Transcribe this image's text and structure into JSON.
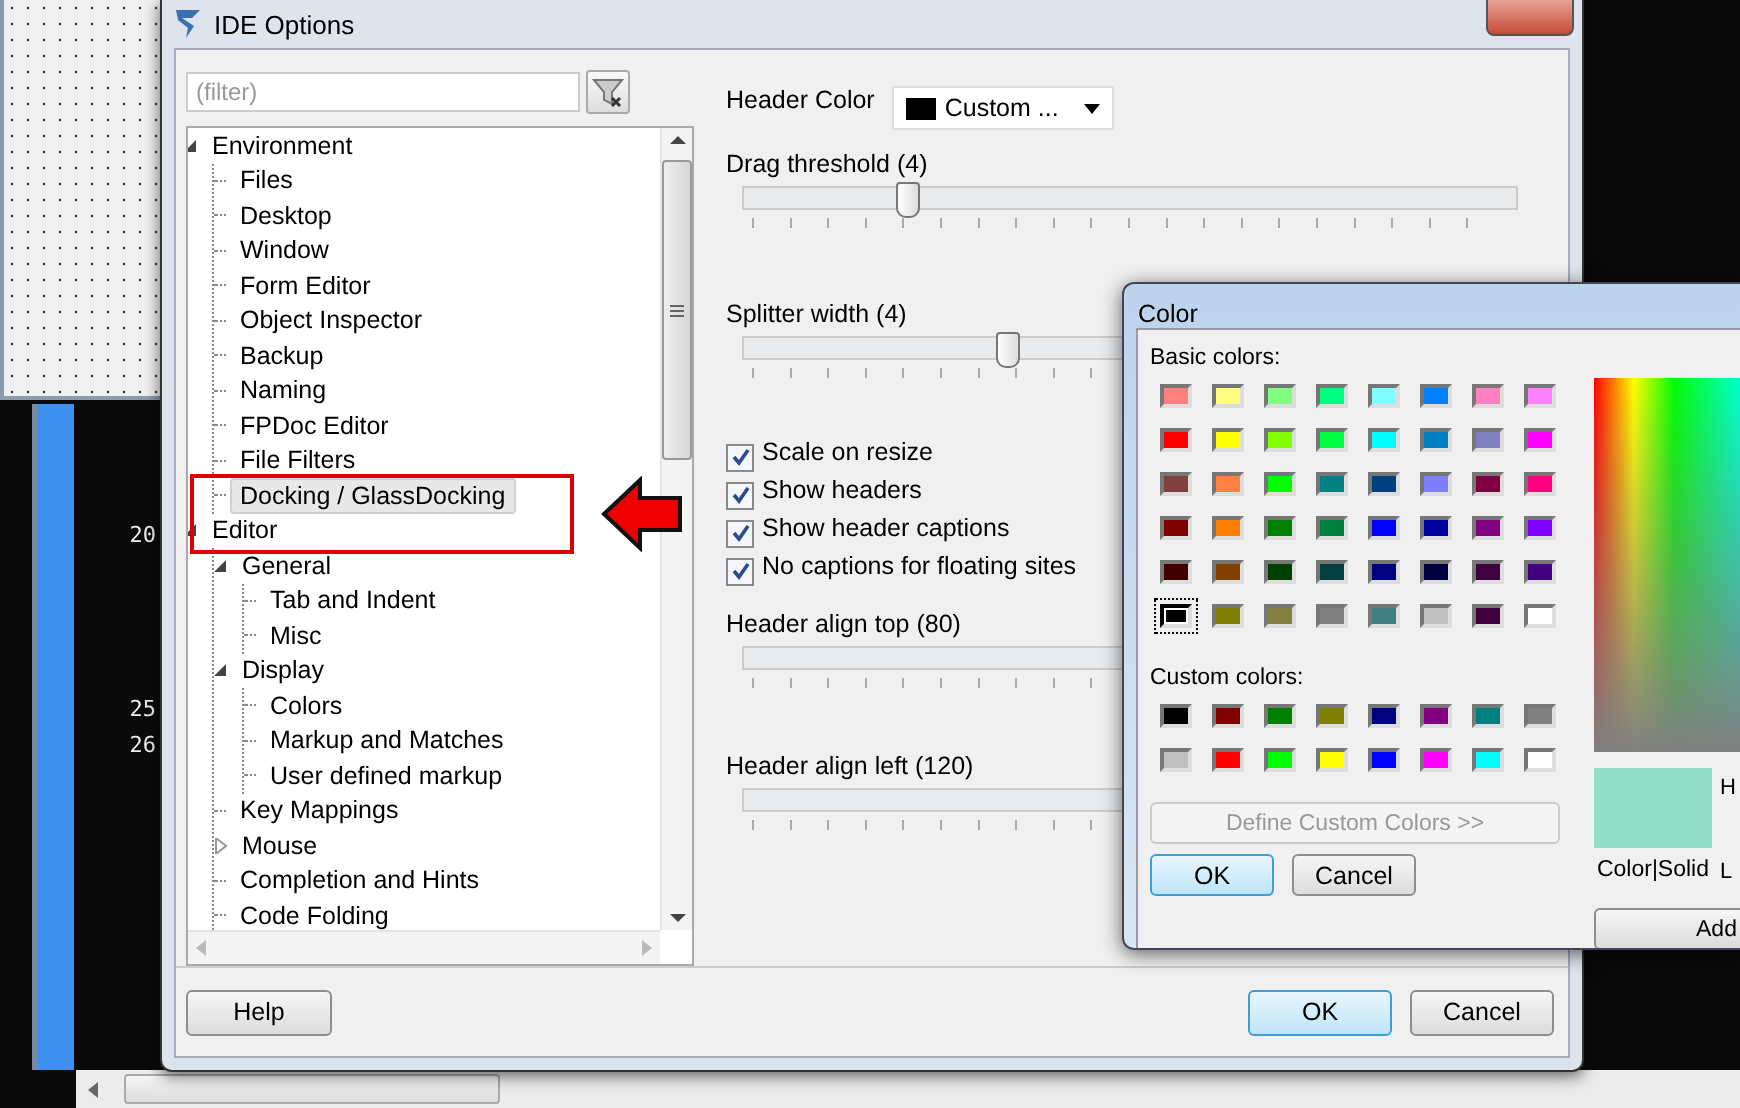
{
  "editor_gutter": [
    {
      "number": "20"
    },
    {
      "number": "25"
    },
    {
      "number": "26"
    }
  ],
  "window": {
    "title": "IDE Options"
  },
  "filter": {
    "placeholder": "(filter)"
  },
  "tree": [
    {
      "label": "Environment",
      "expanded": true,
      "selected": false,
      "children": [
        {
          "label": "Files",
          "selected": false
        },
        {
          "label": "Desktop",
          "selected": false
        },
        {
          "label": "Window",
          "selected": false
        },
        {
          "label": "Form Editor",
          "selected": false
        },
        {
          "label": "Object Inspector",
          "selected": false
        },
        {
          "label": "Backup",
          "selected": false
        },
        {
          "label": "Naming",
          "selected": false
        },
        {
          "label": "FPDoc Editor",
          "selected": false
        },
        {
          "label": "File Filters",
          "selected": false
        },
        {
          "label": "Docking / GlassDocking",
          "selected": true
        }
      ]
    },
    {
      "label": "Editor",
      "expanded": true,
      "selected": false,
      "children": [
        {
          "label": "General",
          "expanded": true,
          "selected": false,
          "children": [
            {
              "label": "Tab and Indent",
              "selected": false
            },
            {
              "label": "Misc",
              "selected": false
            }
          ]
        },
        {
          "label": "Display",
          "expanded": true,
          "selected": false,
          "children": [
            {
              "label": "Colors",
              "selected": false
            },
            {
              "label": "Markup and Matches",
              "selected": false
            },
            {
              "label": "User defined markup",
              "selected": false
            }
          ]
        },
        {
          "label": "Key Mappings",
          "selected": false
        },
        {
          "label": "Mouse",
          "expanded": false,
          "selected": false
        },
        {
          "label": "Completion and Hints",
          "selected": false
        },
        {
          "label": "Code Folding",
          "selected": false
        }
      ]
    }
  ],
  "options": [
    {
      "kind": "combo",
      "label": "Header Color",
      "value": "Custom ..."
    },
    {
      "kind": "slider",
      "label": "Drag threshold (4)",
      "level": 0.21
    },
    {
      "kind": "slider",
      "label": "Splitter width (4)",
      "level": 0.34
    },
    {
      "kind": "checkbox",
      "label": "Scale on resize",
      "checked": true
    },
    {
      "kind": "checkbox",
      "label": "Show headers",
      "checked": true
    },
    {
      "kind": "checkbox",
      "label": "Show header captions",
      "checked": true
    },
    {
      "kind": "checkbox",
      "label": "No captions for floating sites",
      "checked": true
    },
    {
      "kind": "slider",
      "label": "Header align top (80)"
    },
    {
      "kind": "slider",
      "label": "Header align left (120)"
    }
  ],
  "footer_buttons": [
    {
      "label": "Help",
      "default": false
    },
    {
      "label": "OK",
      "default": true
    },
    {
      "label": "Cancel",
      "default": false
    }
  ],
  "color_dialog": {
    "title": "Color",
    "basic_label": "Basic colors:",
    "basic_colors": [
      {
        "color": "#ff8080",
        "selected": false
      },
      {
        "color": "#ffff80",
        "selected": false
      },
      {
        "color": "#80ff80",
        "selected": false
      },
      {
        "color": "#00ff80",
        "selected": false
      },
      {
        "color": "#80ffff",
        "selected": false
      },
      {
        "color": "#0080ff",
        "selected": false
      },
      {
        "color": "#ff80c0",
        "selected": false
      },
      {
        "color": "#ff80ff",
        "selected": false
      },
      {
        "color": "#ff0000",
        "selected": false
      },
      {
        "color": "#ffff00",
        "selected": false
      },
      {
        "color": "#80ff00",
        "selected": false
      },
      {
        "color": "#00ff40",
        "selected": false
      },
      {
        "color": "#00ffff",
        "selected": false
      },
      {
        "color": "#0080c0",
        "selected": false
      },
      {
        "color": "#8080c0",
        "selected": false
      },
      {
        "color": "#ff00ff",
        "selected": false
      },
      {
        "color": "#804040",
        "selected": false
      },
      {
        "color": "#ff8040",
        "selected": false
      },
      {
        "color": "#00ff00",
        "selected": false
      },
      {
        "color": "#008080",
        "selected": false
      },
      {
        "color": "#004080",
        "selected": false
      },
      {
        "color": "#8080ff",
        "selected": false
      },
      {
        "color": "#800040",
        "selected": false
      },
      {
        "color": "#ff0080",
        "selected": false
      },
      {
        "color": "#800000",
        "selected": false
      },
      {
        "color": "#ff8000",
        "selected": false
      },
      {
        "color": "#008000",
        "selected": false
      },
      {
        "color": "#008040",
        "selected": false
      },
      {
        "color": "#0000ff",
        "selected": false
      },
      {
        "color": "#0000a0",
        "selected": false
      },
      {
        "color": "#800080",
        "selected": false
      },
      {
        "color": "#8000ff",
        "selected": false
      },
      {
        "color": "#400000",
        "selected": false
      },
      {
        "color": "#804000",
        "selected": false
      },
      {
        "color": "#004000",
        "selected": false
      },
      {
        "color": "#004040",
        "selected": false
      },
      {
        "color": "#000080",
        "selected": false
      },
      {
        "color": "#000040",
        "selected": false
      },
      {
        "color": "#400040",
        "selected": false
      },
      {
        "color": "#400080",
        "selected": false
      },
      {
        "color": "#000000",
        "selected": true
      },
      {
        "color": "#808000",
        "selected": false
      },
      {
        "color": "#808040",
        "selected": false
      },
      {
        "color": "#808080",
        "selected": false
      },
      {
        "color": "#408080",
        "selected": false
      },
      {
        "color": "#c0c0c0",
        "selected": false
      },
      {
        "color": "#400040",
        "selected": false
      },
      {
        "color": "#ffffff",
        "selected": false
      }
    ],
    "custom_label": "Custom colors:",
    "custom_colors": [
      {
        "color": "#000000"
      },
      {
        "color": "#800000"
      },
      {
        "color": "#008000"
      },
      {
        "color": "#808000"
      },
      {
        "color": "#000080"
      },
      {
        "color": "#800080"
      },
      {
        "color": "#008080"
      },
      {
        "color": "#808080"
      },
      {
        "color": "#c0c0c0"
      },
      {
        "color": "#ff0000"
      },
      {
        "color": "#00ff00"
      },
      {
        "color": "#ffff00"
      },
      {
        "color": "#0000ff"
      },
      {
        "color": "#ff00ff"
      },
      {
        "color": "#00ffff"
      },
      {
        "color": "#ffffff"
      }
    ],
    "define_button": {
      "label": "Define Custom Colors >>",
      "disabled": true
    },
    "buttons": [
      {
        "label": "OK",
        "default": true
      },
      {
        "label": "Cancel",
        "default": false
      }
    ],
    "preview_label": "Color|Solid",
    "field_labels": [
      "H",
      "L"
    ],
    "add_button": "Add"
  }
}
